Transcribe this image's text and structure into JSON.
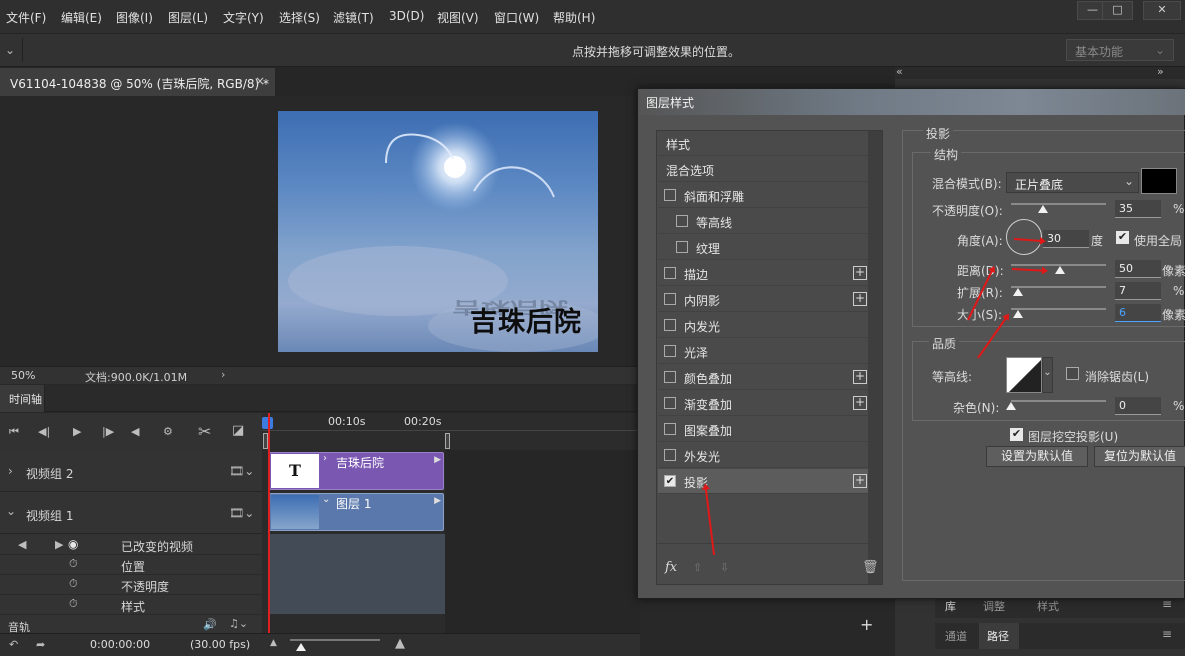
{
  "menubar": {
    "items": [
      "文件(F)",
      "编辑(E)",
      "图像(I)",
      "图层(L)",
      "文字(Y)",
      "选择(S)",
      "滤镜(T)",
      "3D(D)",
      "视图(V)",
      "窗口(W)",
      "帮助(H)"
    ]
  },
  "optionsbar": {
    "hint": "点按并拖移可调整效果的位置。",
    "workspace": "基本功能"
  },
  "document": {
    "tab_title": "V61104-104838 @ 50% (吉珠后院, RGB/8) *",
    "close": "×",
    "image_text": "吉珠后院",
    "zoom": "50%",
    "doc_info": "文档:900.0K/1.01M"
  },
  "timeline": {
    "panel_title": "时间轴",
    "t1": "00:10s",
    "t2": "00:20s",
    "group2": "视频组 2",
    "group1": "视频组 1",
    "clip_text": "吉珠后院",
    "clip_text_icon": "T",
    "clip_layer": "图层 1",
    "track_changed": "已改变的视频",
    "track_pos": "位置",
    "track_opacity": "不透明度",
    "track_style": "样式",
    "audio": "音轨",
    "timecode": "0:00:00:00",
    "fps": "(30.00 fps)"
  },
  "rightpanel": {
    "tabs_bottom1": [
      "库",
      "调整",
      "样式"
    ],
    "tabs_bottom2": [
      "通道",
      "路径"
    ]
  },
  "dialog": {
    "title": "图层样式",
    "list": [
      {
        "label": "样式",
        "checkbox": false,
        "plus": false,
        "indent": false
      },
      {
        "label": "混合选项",
        "checkbox": false,
        "plus": false,
        "indent": false
      },
      {
        "label": "斜面和浮雕",
        "checkbox": true,
        "checked": false,
        "plus": false,
        "indent": false
      },
      {
        "label": "等高线",
        "checkbox": true,
        "checked": false,
        "plus": false,
        "indent": true
      },
      {
        "label": "纹理",
        "checkbox": true,
        "checked": false,
        "plus": false,
        "indent": true
      },
      {
        "label": "描边",
        "checkbox": true,
        "checked": false,
        "plus": true,
        "indent": false
      },
      {
        "label": "内阴影",
        "checkbox": true,
        "checked": false,
        "plus": true,
        "indent": false
      },
      {
        "label": "内发光",
        "checkbox": true,
        "checked": false,
        "plus": false,
        "indent": false
      },
      {
        "label": "光泽",
        "checkbox": true,
        "checked": false,
        "plus": false,
        "indent": false
      },
      {
        "label": "颜色叠加",
        "checkbox": true,
        "checked": false,
        "plus": true,
        "indent": false
      },
      {
        "label": "渐变叠加",
        "checkbox": true,
        "checked": false,
        "plus": true,
        "indent": false
      },
      {
        "label": "图案叠加",
        "checkbox": true,
        "checked": false,
        "plus": false,
        "indent": false
      },
      {
        "label": "外发光",
        "checkbox": true,
        "checked": false,
        "plus": false,
        "indent": false
      },
      {
        "label": "投影",
        "checkbox": true,
        "checked": true,
        "plus": true,
        "indent": false
      }
    ],
    "fx": "fx",
    "section_title": "投影",
    "structure": "结构",
    "blend_mode_label": "混合模式(B):",
    "blend_mode_value": "正片叠底",
    "opacity_label": "不透明度(O):",
    "opacity_value": "35",
    "opacity_unit": "%",
    "angle_label": "角度(A):",
    "angle_value": "30",
    "angle_unit": "度",
    "global_light": "使用全局",
    "distance_label": "距离(D):",
    "distance_value": "50",
    "distance_unit": "像素",
    "spread_label": "扩展(R):",
    "spread_value": "7",
    "spread_unit": "%",
    "size_label": "大小(S):",
    "size_value": "6",
    "size_unit": "像素",
    "quality": "品质",
    "contour_label": "等高线:",
    "antialias": "消除锯齿(L)",
    "noise_label": "杂色(N):",
    "noise_value": "0",
    "noise_unit": "%",
    "knockout": "图层挖空投影(U)",
    "set_default": "设置为默认值",
    "reset_default": "复位为默认值"
  },
  "colors": {
    "shadow_color": "#000000",
    "clip_purple": "#7a58b2",
    "clip_blue": "#5a78ab",
    "arrow_red": "#e01818"
  }
}
